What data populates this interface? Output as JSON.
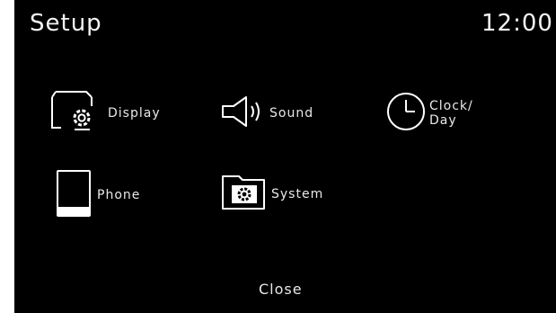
{
  "header": {
    "title": "Setup",
    "clock": "12:00"
  },
  "menu": {
    "items": [
      {
        "label": "Display",
        "icon": "display-settings-icon"
      },
      {
        "label": "Sound",
        "icon": "speaker-icon"
      },
      {
        "label": "Clock/\nDay",
        "icon": "clock-icon"
      },
      {
        "label": "Phone",
        "icon": "phone-icon"
      },
      {
        "label": "System",
        "icon": "system-folder-icon"
      }
    ]
  },
  "footer": {
    "close_label": "Close"
  },
  "colors": {
    "background": "#000000",
    "foreground": "#ffffff"
  }
}
